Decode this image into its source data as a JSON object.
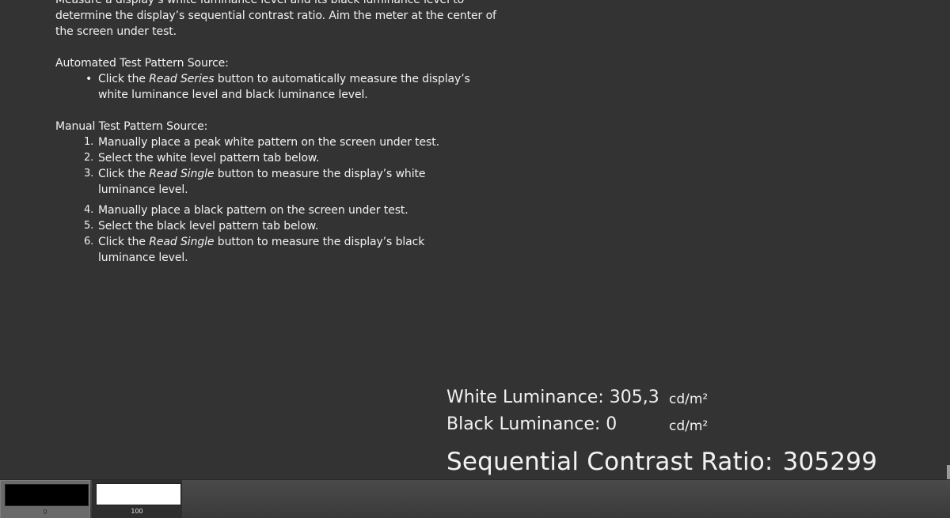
{
  "instructions": {
    "intro_line1": "Measure a display’s white luminance level and its black luminance level to",
    "intro_line2": "determine the display’s sequential contrast ratio. Aim the meter at the center of",
    "intro_line3": "the screen under test.",
    "automated": {
      "title": "Automated Test Pattern Source:",
      "bullet_pre": "Click the ",
      "bullet_em": "Read Series",
      "bullet_post": " button to automatically measure the display’s white luminance level and black luminance level."
    },
    "manual": {
      "title": "Manual Test Pattern Source:",
      "steps": [
        {
          "num": "1.",
          "text": "Manually place a peak white pattern on the screen under test."
        },
        {
          "num": "2.",
          "text": "Select the white level pattern tab below."
        },
        {
          "num": "3.",
          "pre": "Click the ",
          "em": "Read Single",
          "post": " button to measure the display’s white luminance level."
        },
        {
          "num": "4.",
          "text": "Manually place a black pattern on the screen under test."
        },
        {
          "num": "5.",
          "text": "Select the black level pattern tab below."
        },
        {
          "num": "6.",
          "pre": "Click the ",
          "em": "Read Single",
          "post": " button to measure the display’s black luminance level."
        }
      ]
    }
  },
  "readouts": {
    "white_label": "White Luminance:",
    "white_value": "305,3",
    "white_unit": "cd/m²",
    "black_label": "Black Luminance:",
    "black_value": "0",
    "black_unit": "cd/m²",
    "ratio_label": "Sequential Contrast Ratio:",
    "ratio_value": "305299"
  },
  "tabs": [
    {
      "label": "0",
      "swatch_color": "#000000"
    },
    {
      "label": "100",
      "swatch_color": "#ffffff"
    }
  ],
  "colors": {
    "background": "#333333",
    "text": "#f2f2f2",
    "tab_bar": "#444444",
    "selected_tab": "#6a6a6a"
  }
}
